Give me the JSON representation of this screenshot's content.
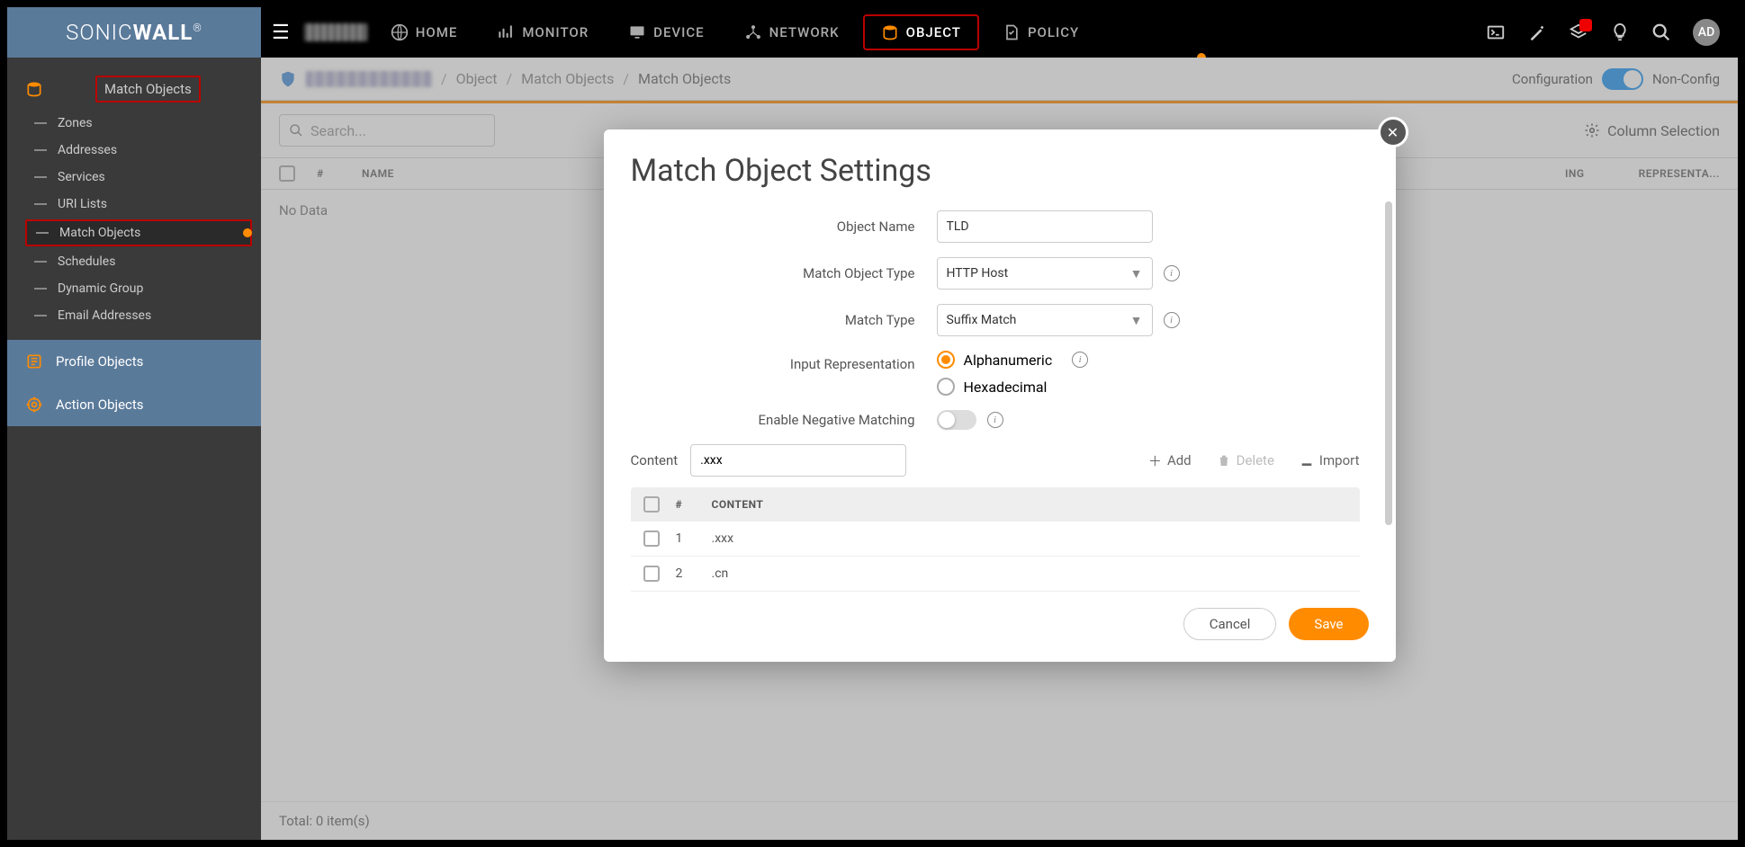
{
  "brand": {
    "part1": "SONIC",
    "part2": "WALL"
  },
  "topnav": {
    "home": "HOME",
    "monitor": "MONITOR",
    "device": "DEVICE",
    "network": "NETWORK",
    "object": "OBJECT",
    "policy": "POLICY"
  },
  "avatar": "AD",
  "sidebar": {
    "group_head": "Match Objects",
    "items": [
      "Zones",
      "Addresses",
      "Services",
      "URI Lists",
      "Match Objects",
      "Schedules",
      "Dynamic Group",
      "Email Addresses"
    ],
    "profile": "Profile Objects",
    "action": "Action Objects"
  },
  "breadcrumb": {
    "object": "Object",
    "match_objects": "Match Objects",
    "match_objects2": "Match Objects",
    "config": "Configuration",
    "nonconfig": "Non-Config"
  },
  "toolbar": {
    "search_placeholder": "Search...",
    "colsel": "Column Selection"
  },
  "table": {
    "num": "#",
    "name": "NAME",
    "ing": "ING",
    "rep": "REPRESENTA...",
    "nodata": "No Data",
    "footer": "Total:  0 item(s)"
  },
  "modal": {
    "title": "Match Object Settings",
    "object_name_label": "Object Name",
    "object_name_value": "TLD",
    "match_object_type_label": "Match Object Type",
    "match_object_type_value": "HTTP Host",
    "match_type_label": "Match Type",
    "match_type_value": "Suffix Match",
    "input_rep_label": "Input Representation",
    "input_rep_alpha": "Alphanumeric",
    "input_rep_hex": "Hexadecimal",
    "neg_match_label": "Enable Negative Matching",
    "content_label": "Content",
    "content_value": ".xxx",
    "add": "Add",
    "delete": "Delete",
    "import": "Import",
    "ctable_num": "#",
    "ctable_content": "CONTENT",
    "rows": [
      {
        "n": "1",
        "c": ".xxx"
      },
      {
        "n": "2",
        "c": ".cn"
      }
    ],
    "cancel": "Cancel",
    "save": "Save"
  }
}
